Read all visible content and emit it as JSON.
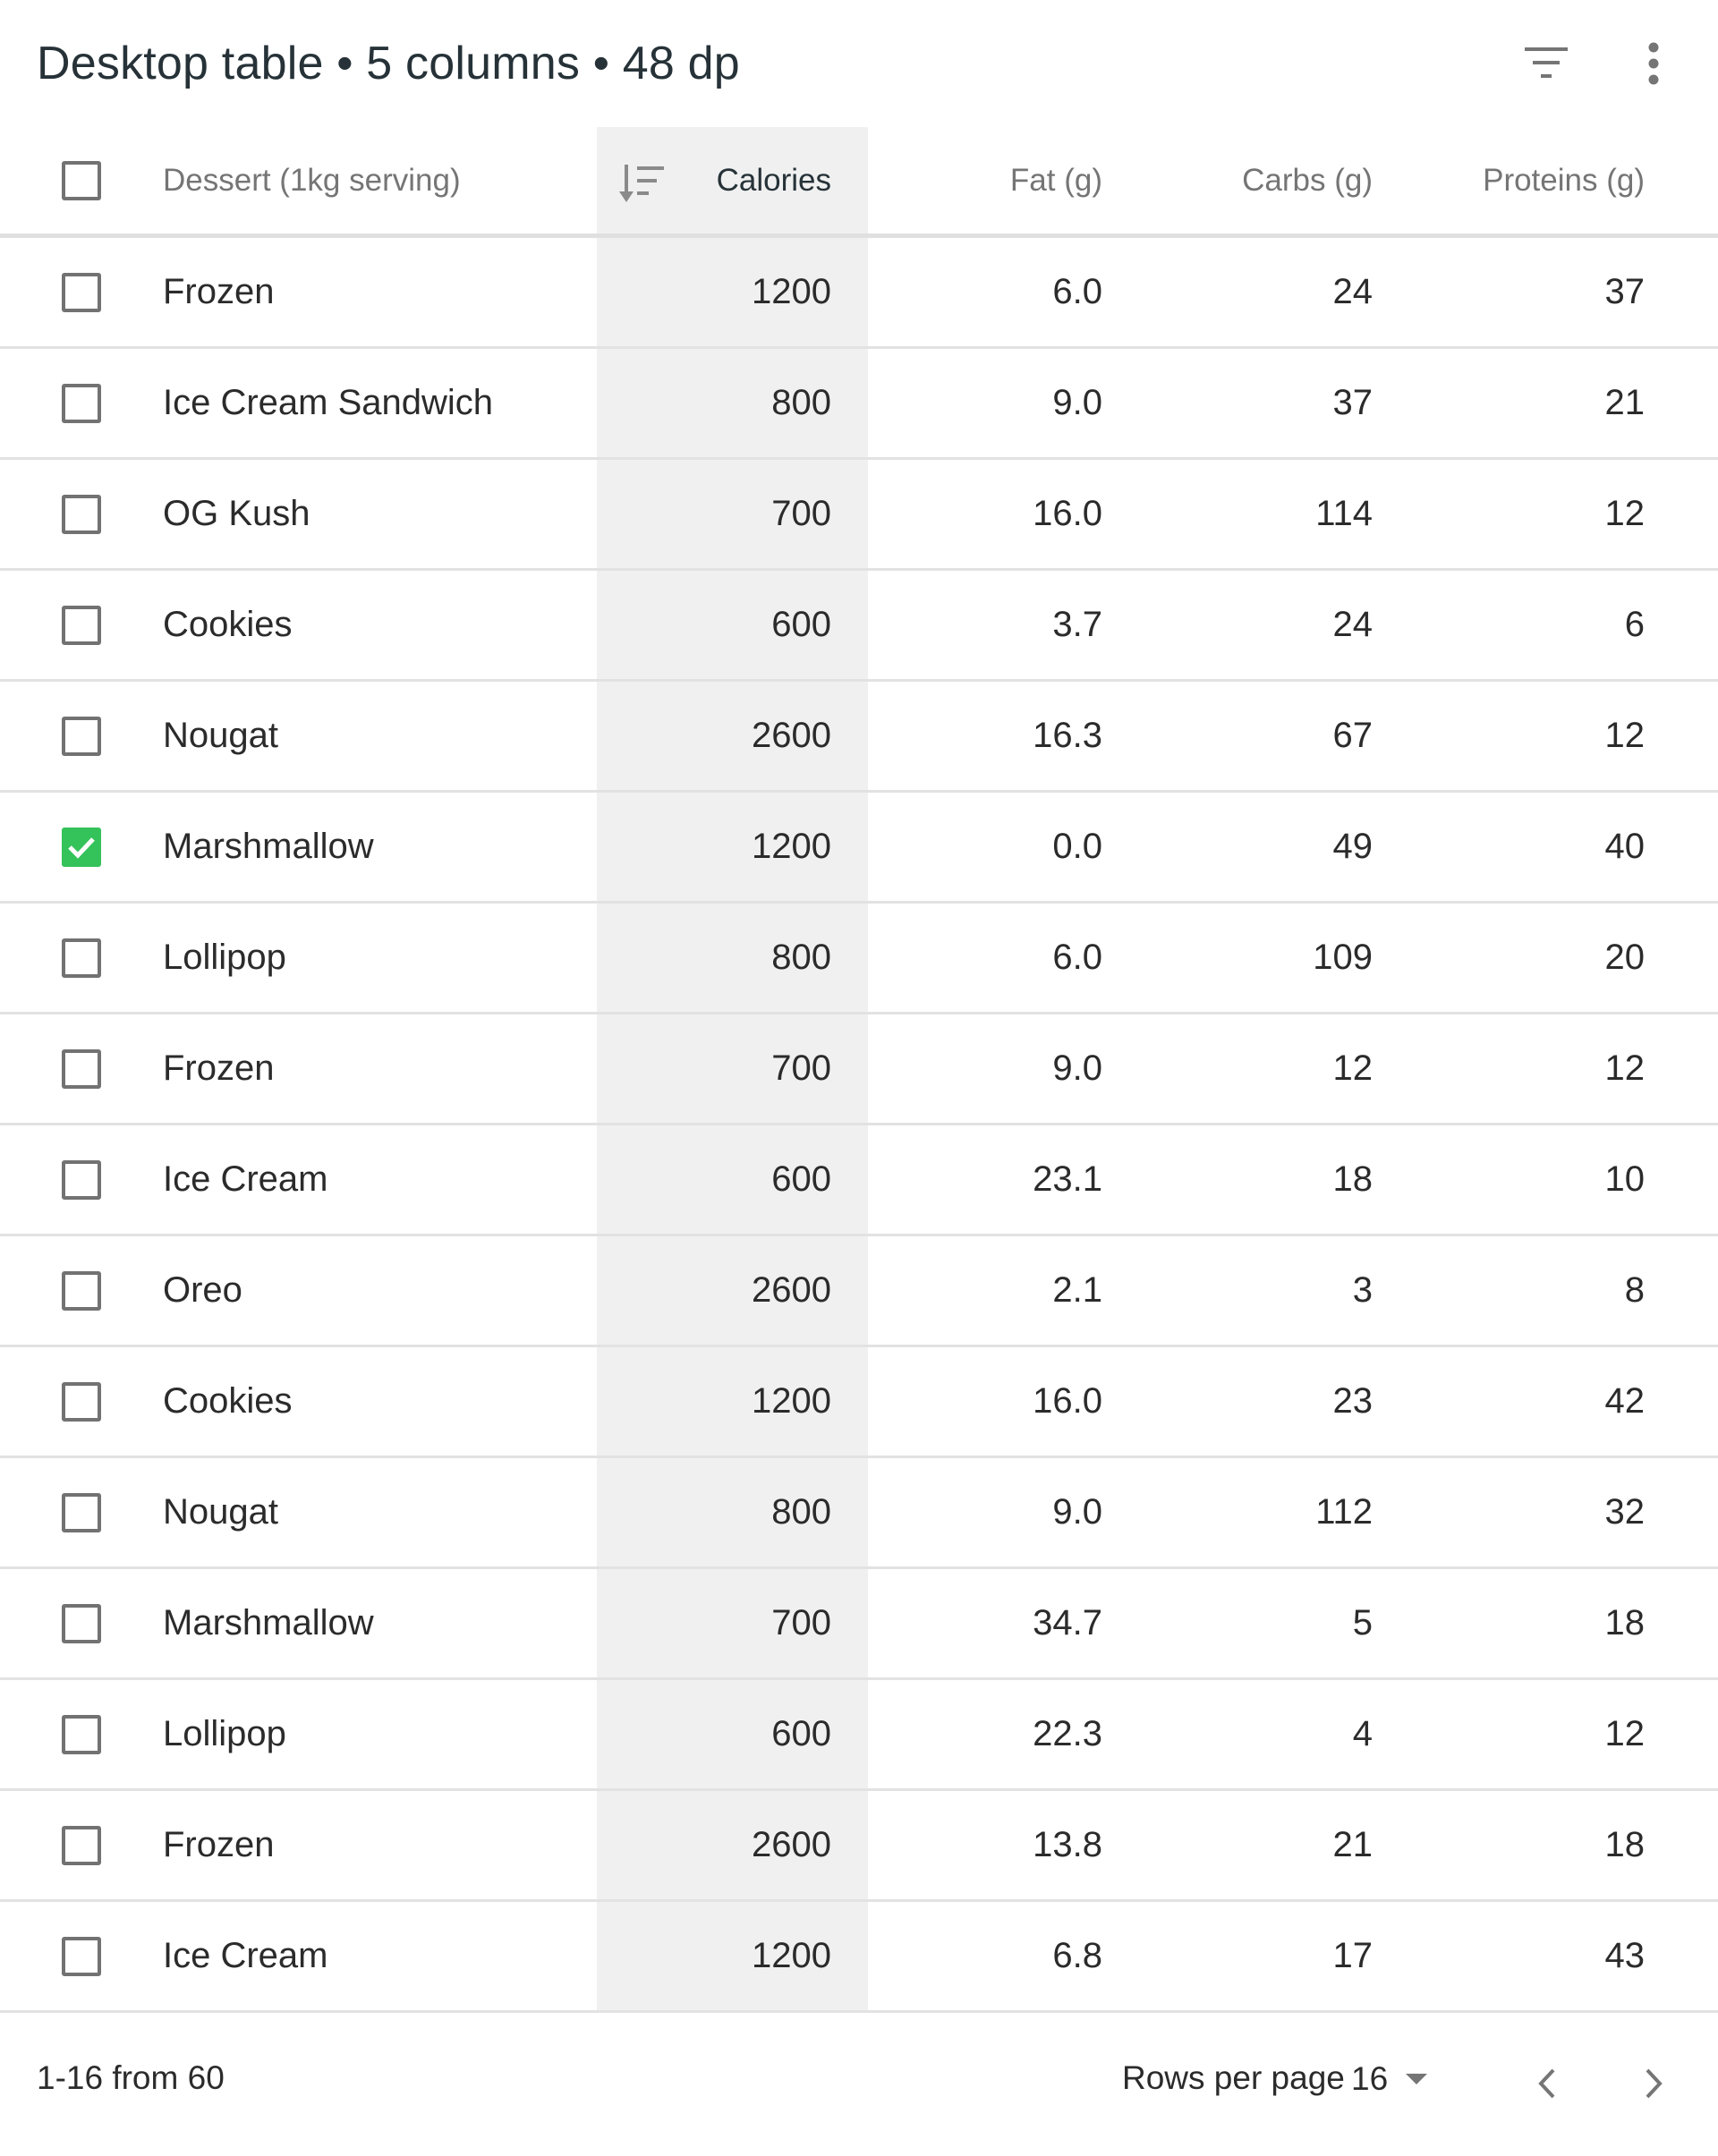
{
  "header": {
    "title": "Desktop table • 5 columns • 48 dp"
  },
  "icons": {
    "filter": "filter-icon",
    "more": "more-vert-icon",
    "sort": "sort-descending-icon",
    "check": "check-icon",
    "prev": "chevron-left-icon",
    "next": "chevron-right-icon",
    "dropdown": "arrow-drop-down-icon"
  },
  "colors": {
    "checked": "#34c25a",
    "sorted_column_bg": "#f0f0f0"
  },
  "table": {
    "columns": {
      "name": "Dessert (1kg serving)",
      "calories": "Calories",
      "fat": "Fat (g)",
      "carbs": "Carbs (g)",
      "proteins": "Proteins (g)"
    },
    "sorted_by": "Calories",
    "select_all_checked": false,
    "rows": [
      {
        "checked": false,
        "name": "Frozen",
        "calories": "1200",
        "fat": "6.0",
        "carbs": "24",
        "proteins": "37"
      },
      {
        "checked": false,
        "name": "Ice Cream Sandwich",
        "calories": "800",
        "fat": "9.0",
        "carbs": "37",
        "proteins": "21"
      },
      {
        "checked": false,
        "name": "OG Kush",
        "calories": "700",
        "fat": "16.0",
        "carbs": "114",
        "proteins": "12"
      },
      {
        "checked": false,
        "name": "Cookies",
        "calories": "600",
        "fat": "3.7",
        "carbs": "24",
        "proteins": "6"
      },
      {
        "checked": false,
        "name": "Nougat",
        "calories": "2600",
        "fat": "16.3",
        "carbs": "67",
        "proteins": "12"
      },
      {
        "checked": true,
        "name": "Marshmallow",
        "calories": "1200",
        "fat": "0.0",
        "carbs": "49",
        "proteins": "40"
      },
      {
        "checked": false,
        "name": "Lollipop",
        "calories": "800",
        "fat": "6.0",
        "carbs": "109",
        "proteins": "20"
      },
      {
        "checked": false,
        "name": "Frozen",
        "calories": "700",
        "fat": "9.0",
        "carbs": "12",
        "proteins": "12"
      },
      {
        "checked": false,
        "name": "Ice Cream",
        "calories": "600",
        "fat": "23.1",
        "carbs": "18",
        "proteins": "10"
      },
      {
        "checked": false,
        "name": "Oreo",
        "calories": "2600",
        "fat": "2.1",
        "carbs": "3",
        "proteins": "8"
      },
      {
        "checked": false,
        "name": "Cookies",
        "calories": "1200",
        "fat": "16.0",
        "carbs": "23",
        "proteins": "42"
      },
      {
        "checked": false,
        "name": "Nougat",
        "calories": "800",
        "fat": "9.0",
        "carbs": "112",
        "proteins": "32"
      },
      {
        "checked": false,
        "name": "Marshmallow",
        "calories": "700",
        "fat": "34.7",
        "carbs": "5",
        "proteins": "18"
      },
      {
        "checked": false,
        "name": "Lollipop",
        "calories": "600",
        "fat": "22.3",
        "carbs": "4",
        "proteins": "12"
      },
      {
        "checked": false,
        "name": "Frozen",
        "calories": "2600",
        "fat": "13.8",
        "carbs": "21",
        "proteins": "18"
      },
      {
        "checked": false,
        "name": "Ice Cream",
        "calories": "1200",
        "fat": "6.8",
        "carbs": "17",
        "proteins": "43"
      }
    ]
  },
  "footer": {
    "range": "1-16 from 60",
    "rows_per_page_label": "Rows per page",
    "rows_per_page_value": "16"
  }
}
